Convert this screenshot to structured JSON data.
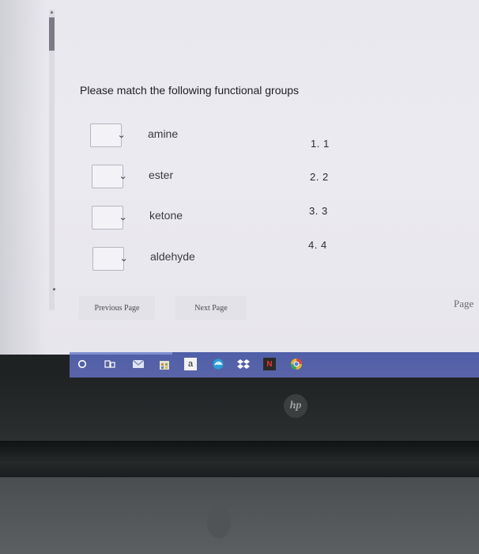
{
  "question": {
    "title": "Please match the following functional groups"
  },
  "terms": [
    {
      "label": "amine"
    },
    {
      "label": "ester"
    },
    {
      "label": "ketone"
    },
    {
      "label": "aldehyde"
    }
  ],
  "numbered_options": [
    {
      "text": "1.  1"
    },
    {
      "text": "2.  2"
    },
    {
      "text": "3.  3"
    },
    {
      "text": "4.  4"
    }
  ],
  "navigation": {
    "previous_label": "Previous Page",
    "next_label": "Next Page",
    "page_label": "Page"
  },
  "taskbar": {
    "icons": [
      "start-circle-icon",
      "task-view-icon",
      "mail-icon",
      "store-icon",
      "amazon-icon",
      "edge-icon",
      "dropbox-icon",
      "netflix-icon",
      "chrome-icon"
    ],
    "amazon_glyph": "a",
    "netflix_glyph": "N"
  },
  "device": {
    "logo": "hp"
  },
  "colors": {
    "taskbar": "#5a64a8",
    "screen_bg": "#ebeaf0"
  }
}
